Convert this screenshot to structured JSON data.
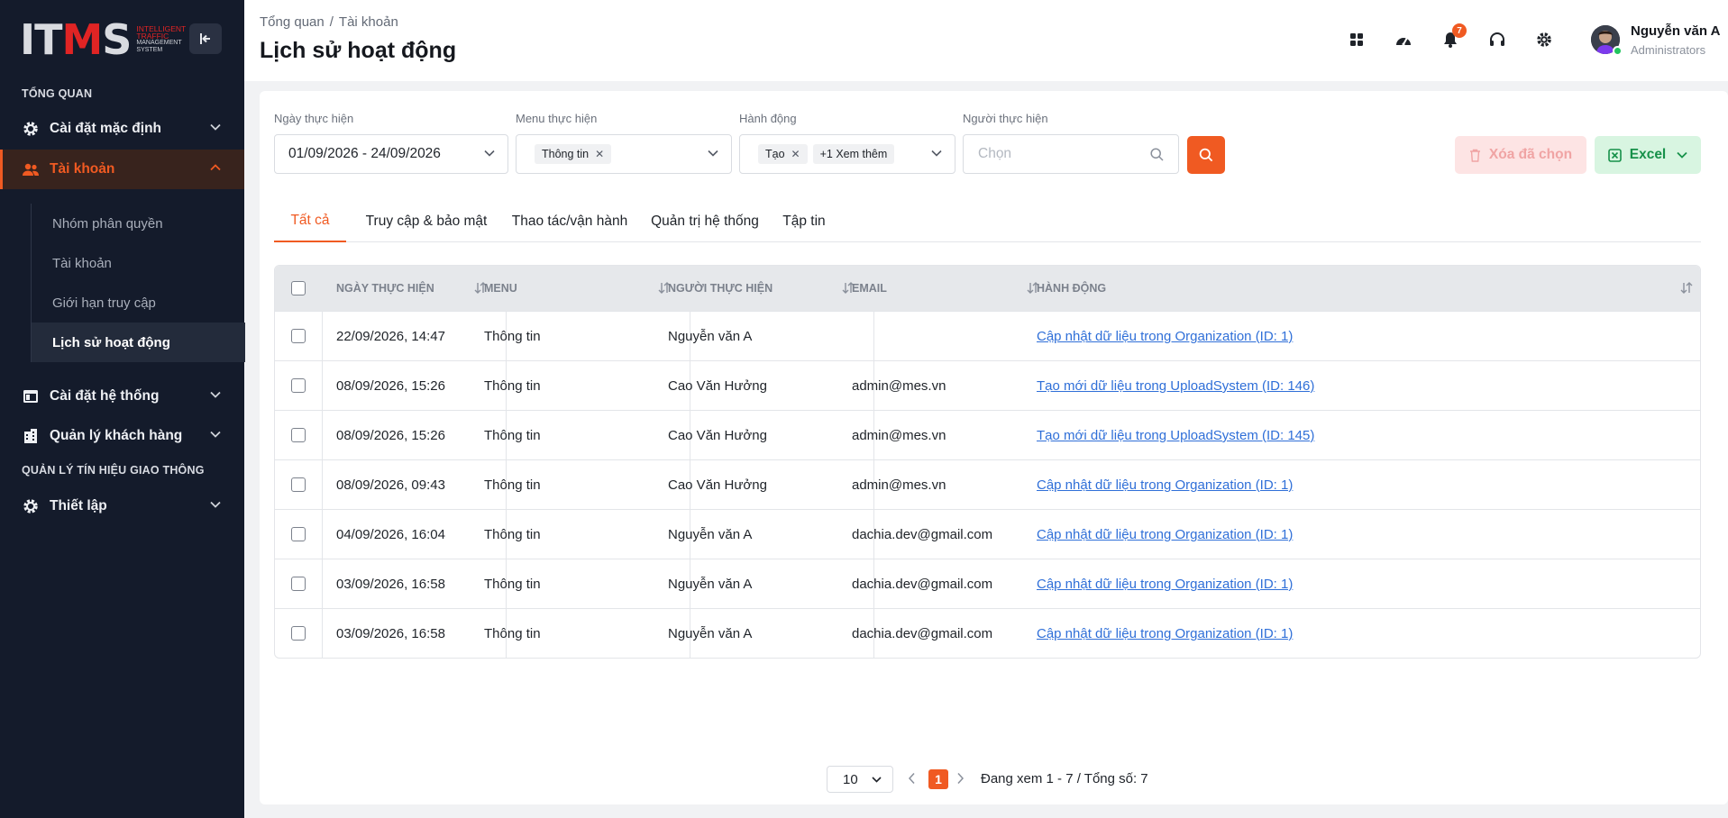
{
  "logo": {
    "mark_a": "IT",
    "mark_b": "M",
    "mark_c": "S",
    "sub1": "INTELLIGENT",
    "sub2": "TRAFFIC",
    "sub3": "MANAGEMENT",
    "sub4": "SYSTEM"
  },
  "sidebar": {
    "section_overview": "TỔNG QUAN",
    "items": [
      {
        "label": "Cài đặt mặc định",
        "icon": "gear-icon"
      },
      {
        "label": "Tài khoản",
        "icon": "users-icon"
      },
      {
        "label": "Cài đặt hệ thống",
        "icon": "window-icon"
      },
      {
        "label": "Quản lý khách hàng",
        "icon": "building-icon"
      }
    ],
    "subitems": [
      "Nhóm phân quyền",
      "Tài khoản",
      "Giới hạn truy cập",
      "Lịch sử hoạt động"
    ],
    "section_traffic": "QUẢN LÝ TÍN HIỆU GIAO THÔNG",
    "traffic_items": [
      {
        "label": "Thiết lập",
        "icon": "gear-icon"
      }
    ]
  },
  "header": {
    "breadcrumb": [
      "Tổng quan",
      "Tài khoản"
    ],
    "breadcrumb_sep": "/",
    "title": "Lịch sử hoạt động",
    "notification_count": "7",
    "user_name": "Nguyễn văn A",
    "user_role": "Administrators"
  },
  "filters": {
    "date_label": "Ngày thực hiện",
    "date_value": "01/09/2026 - 24/09/2026",
    "menu_label": "Menu thực hiện",
    "menu_chip": "Thông tin",
    "action_label": "Hành động",
    "action_chip": "Tạo",
    "action_more": "+1 Xem thêm",
    "user_label": "Người thực hiện",
    "user_placeholder": "Chọn",
    "delete_label": "Xóa đã chọn",
    "excel_label": "Excel"
  },
  "tabs": [
    "Tất cả",
    "Truy cập & bảo mật",
    "Thao tác/vận hành",
    "Quản trị hệ thống",
    "Tập tin"
  ],
  "table": {
    "headers": [
      "NGÀY THỰC HIỆN",
      "MENU",
      "NGƯỜI THỰC HIỆN",
      "EMAIL",
      "HÀNH ĐỘNG"
    ],
    "rows": [
      {
        "date": "22/09/2026, 14:47",
        "menu": "Thông tin",
        "user": "Nguyễn văn A",
        "email": "",
        "action": "Cập nhật dữ liệu trong Organization (ID: 1)"
      },
      {
        "date": "08/09/2026, 15:26",
        "menu": "Thông tin",
        "user": "Cao Văn Hưởng",
        "email": "admin@mes.vn",
        "action": "Tạo mới dữ liệu trong UploadSystem (ID: 146)"
      },
      {
        "date": "08/09/2026, 15:26",
        "menu": "Thông tin",
        "user": "Cao Văn Hưởng",
        "email": "admin@mes.vn",
        "action": "Tạo mới dữ liệu trong UploadSystem (ID: 145)"
      },
      {
        "date": "08/09/2026, 09:43",
        "menu": "Thông tin",
        "user": "Cao Văn Hưởng",
        "email": "admin@mes.vn",
        "action": "Cập nhật dữ liệu trong Organization (ID: 1)"
      },
      {
        "date": "04/09/2026, 16:04",
        "menu": "Thông tin",
        "user": "Nguyễn văn A",
        "email": "dachia.dev@gmail.com",
        "action": "Cập nhật dữ liệu trong Organization (ID: 1)"
      },
      {
        "date": "03/09/2026, 16:58",
        "menu": "Thông tin",
        "user": "Nguyễn văn A",
        "email": "dachia.dev@gmail.com",
        "action": "Cập nhật dữ liệu trong Organization (ID: 1)"
      },
      {
        "date": "03/09/2026, 16:58",
        "menu": "Thông tin",
        "user": "Nguyễn văn A",
        "email": "dachia.dev@gmail.com",
        "action": "Cập nhật dữ liệu trong Organization (ID: 1)"
      }
    ]
  },
  "pagination": {
    "page_size": "10",
    "current_page": "1",
    "info": "Đang xem 1 - 7 / Tổng số: 7"
  },
  "colors": {
    "accent": "#f05a22",
    "sidebar_bg": "#141b2b",
    "link": "#2f6fd8",
    "excel": "#17914a",
    "delete": "#f0a4a4"
  }
}
